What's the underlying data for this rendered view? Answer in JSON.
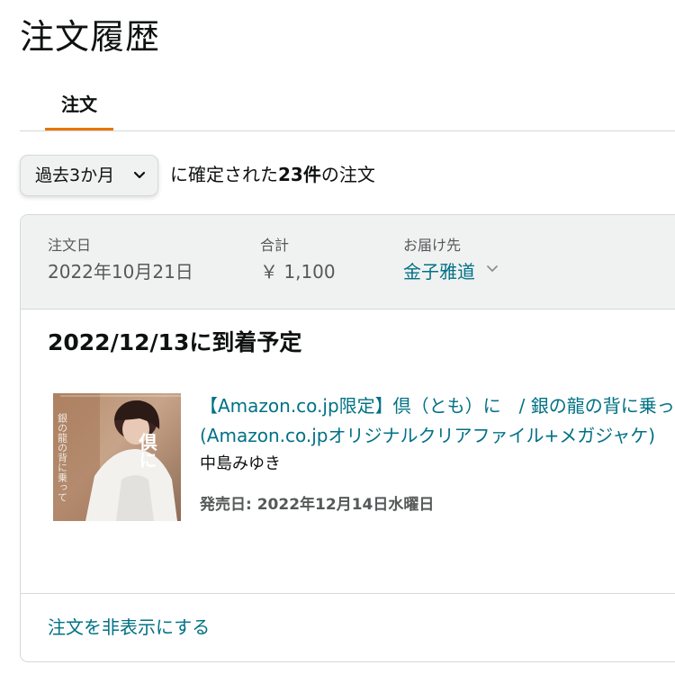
{
  "page": {
    "title": "注文履歴"
  },
  "tabs": [
    {
      "label": "注文",
      "active": true
    }
  ],
  "filter": {
    "selected": "過去3か月",
    "summary_prefix": "に確定された",
    "summary_count": "23件",
    "summary_suffix": "の注文"
  },
  "order": {
    "date_label": "注文日",
    "date_value": "2022年10月21日",
    "total_label": "合計",
    "total_value": "￥ 1,100",
    "ship_label": "お届け先",
    "ship_value": "金子雅道",
    "delivery_status": "2022/12/13に到着予定",
    "item": {
      "title": "【Amazon.co.jp限定】倶（とも）に　/ 銀の龍の背に乗って (Amazon.co.jpオリジナルクリアファイル+メガジャケ)",
      "artist": "中島みゆき",
      "release": "発売日: 2022年12月14日水曜日",
      "cover_text": "倶に"
    },
    "hide_link": "注文を非表示にする"
  },
  "colors": {
    "accent_orange": "#e77600",
    "link": "#007185",
    "header_bg": "#f0f2f2",
    "border": "#d5d9d9"
  }
}
